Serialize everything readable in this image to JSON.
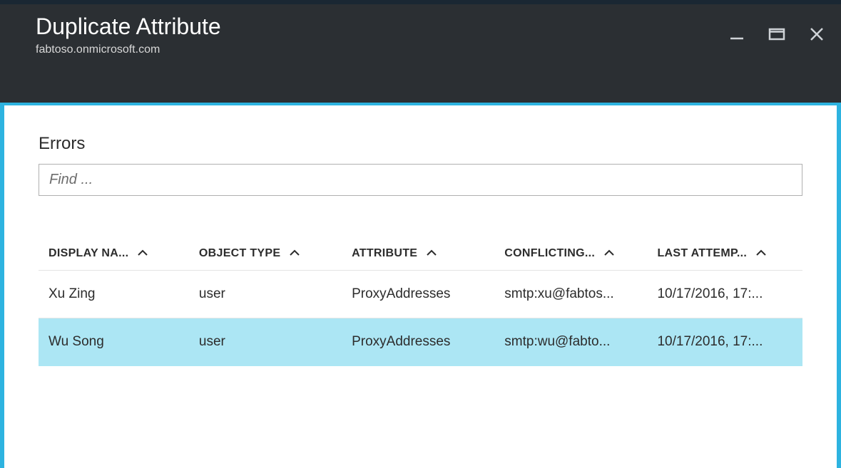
{
  "header": {
    "title": "Duplicate Attribute",
    "subtitle": "fabtoso.onmicrosoft.com"
  },
  "section": {
    "title": "Errors"
  },
  "search": {
    "placeholder": "Find ..."
  },
  "table": {
    "columns": [
      {
        "label": "DISPLAY NA..."
      },
      {
        "label": "OBJECT TYPE"
      },
      {
        "label": "ATTRIBUTE"
      },
      {
        "label": "CONFLICTING..."
      },
      {
        "label": "LAST ATTEMP..."
      }
    ],
    "rows": [
      {
        "display_name": "Xu Zing",
        "object_type": "user",
        "attribute": "ProxyAddresses",
        "conflicting": "smtp:xu@fabtos...",
        "last_attempt": "10/17/2016, 17:..."
      },
      {
        "display_name": "Wu Song",
        "object_type": "user",
        "attribute": "ProxyAddresses",
        "conflicting": "smtp:wu@fabto...",
        "last_attempt": "10/17/2016, 17:..."
      }
    ],
    "selected_index": 1
  }
}
